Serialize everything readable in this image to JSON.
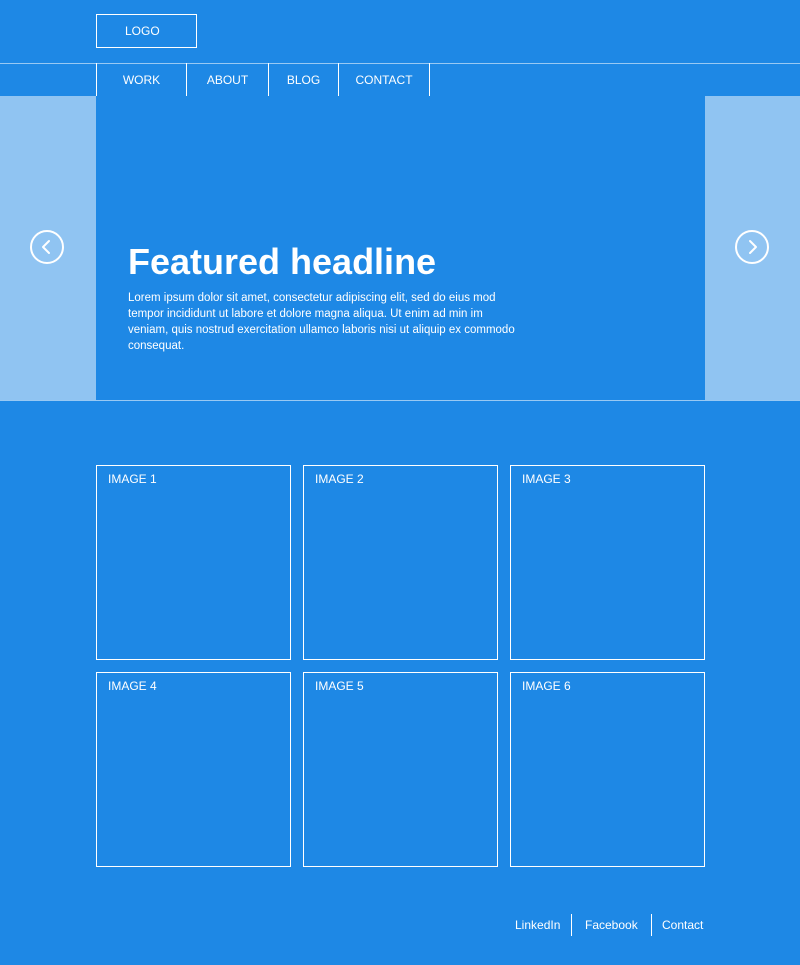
{
  "header": {
    "logo_label": "LOGO"
  },
  "nav": {
    "items": [
      {
        "label": "WORK"
      },
      {
        "label": "ABOUT"
      },
      {
        "label": "BLOG"
      },
      {
        "label": "CONTACT"
      }
    ]
  },
  "carousel": {
    "headline": "Featured headline",
    "body": "Lorem ipsum dolor sit amet, consectetur adipiscing elit, sed do eius mod tempor incididunt ut labore et dolore magna aliqua. Ut enim ad min im veniam, quis nostrud exercitation ullamco laboris nisi ut aliquip ex commodo consequat.",
    "prev_icon": "chevron-left-icon",
    "next_icon": "chevron-right-icon"
  },
  "gallery": {
    "tiles": [
      {
        "label": "IMAGE 1"
      },
      {
        "label": "IMAGE 2"
      },
      {
        "label": "IMAGE 3"
      },
      {
        "label": "IMAGE 4"
      },
      {
        "label": "IMAGE 5"
      },
      {
        "label": "IMAGE 6"
      }
    ]
  },
  "footer": {
    "links": [
      {
        "label": "LinkedIn"
      },
      {
        "label": "Facebook"
      },
      {
        "label": "Contact"
      }
    ]
  },
  "colors": {
    "background": "#1e88e5",
    "side_panel": "#90c4f2",
    "line": "#ffffff"
  }
}
